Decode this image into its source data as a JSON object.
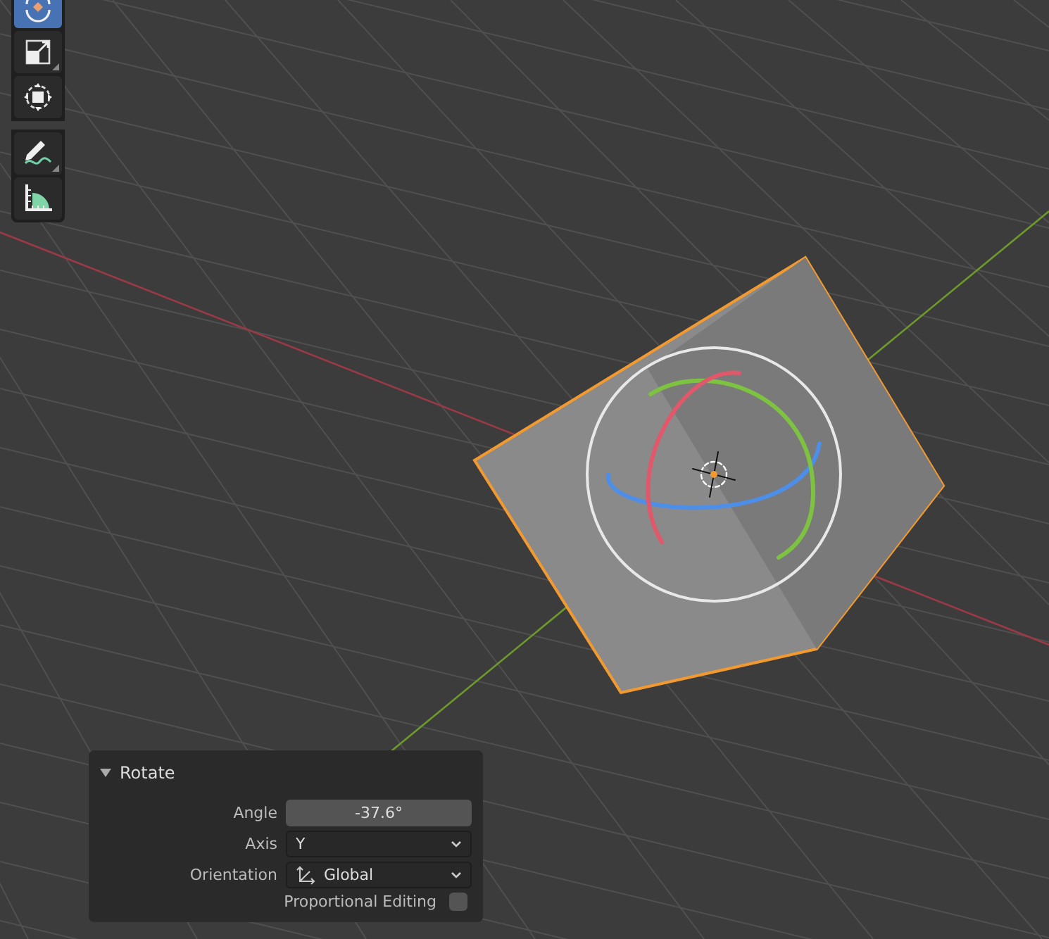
{
  "toolbar": {
    "tools": [
      {
        "kind": "rotate",
        "selected": true,
        "corner": false
      },
      {
        "kind": "scale",
        "selected": false,
        "corner": true
      },
      {
        "kind": "transform",
        "selected": false,
        "corner": false
      },
      {
        "kind": "annotate",
        "selected": false,
        "corner": true
      },
      {
        "kind": "measure",
        "selected": false,
        "corner": false
      }
    ]
  },
  "operator_panel": {
    "title": "Rotate",
    "expanded": true,
    "fields": [
      {
        "kind": "number",
        "label": "Angle",
        "value": "-37.6°"
      },
      {
        "kind": "dropdown",
        "label": "Axis",
        "value": "Y",
        "icon": false
      },
      {
        "kind": "dropdown",
        "label": "Orientation",
        "value": "Global",
        "icon": true
      },
      {
        "kind": "checkbox",
        "label": "Proportional Editing",
        "checked": false
      }
    ]
  }
}
